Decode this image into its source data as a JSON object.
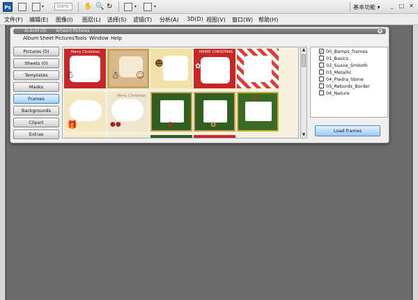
{
  "app_bar": {
    "zoom_value": "100%",
    "workspace_label": "基本功能",
    "workspace_caret": "▾",
    "minimize": "_",
    "restore": "□",
    "close": "✕"
  },
  "menubar": {
    "items": [
      "文件(F)",
      "编辑(E)",
      "图像(I)",
      "图层(L)",
      "选择(S)",
      "滤镜(T)",
      "分析(A)",
      "3D(D)",
      "视图(V)",
      "窗口(W)",
      "帮助(H)"
    ]
  },
  "album_window": {
    "title": "ALBUM DS",
    "subtitle": "Artwort Pictures",
    "close_glyph": "×",
    "menu": [
      "Album",
      "Sheet",
      "Pictures",
      "Tools",
      "Window",
      "Help"
    ],
    "nav_buttons": [
      "Pictures (0)",
      "Sheets (0)",
      "Templates",
      "Masks",
      "Frames",
      "Backgrounds",
      "Clipart",
      "Extras"
    ],
    "active_nav": "Frames",
    "frame_tree": [
      {
        "label": "00_Bamps_frames",
        "checked": true
      },
      {
        "label": "01_Basics",
        "checked": false
      },
      {
        "label": "02_Suave_Smooth",
        "checked": false
      },
      {
        "label": "03_Metallic",
        "checked": false
      },
      {
        "label": "04_Piedra_Stone",
        "checked": false
      },
      {
        "label": "05_Rebords_Border",
        "checked": false
      },
      {
        "label": "06_Nature",
        "checked": false
      }
    ],
    "load_button": "Load frames",
    "thumbnail_captions": [
      "Merry Christmas",
      "Merry Christmas",
      "MERRY CHRISTMAS"
    ],
    "scroll_up": "▲",
    "scroll_down": "▼",
    "check_glyph": "✓"
  },
  "colors": {
    "accent_blue": "#9cc9f5",
    "frame_red": "#c62828",
    "frame_green": "#2f5e1e",
    "frame_gold": "#c9a25a"
  }
}
